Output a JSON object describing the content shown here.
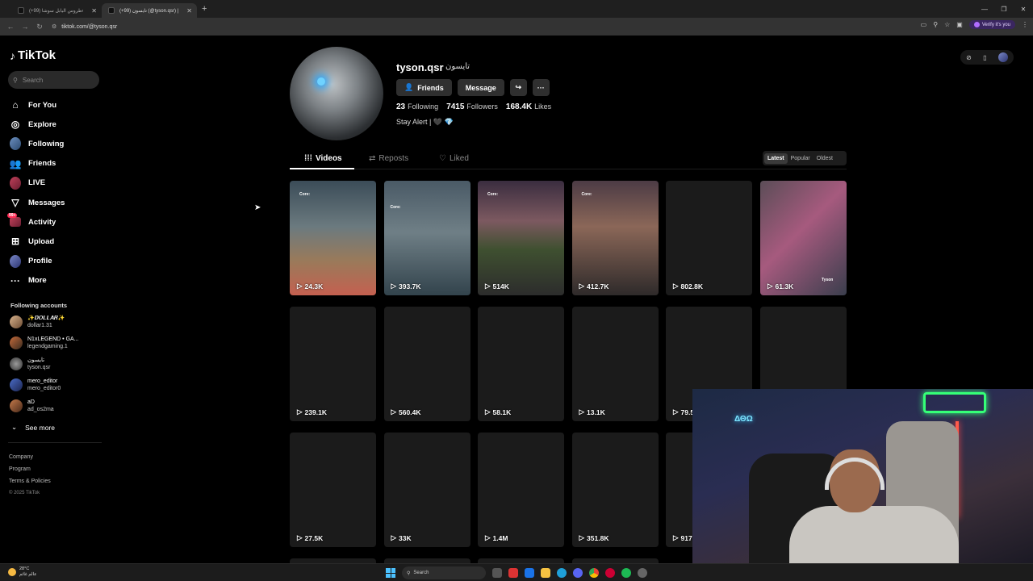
{
  "browser": {
    "tabs": [
      {
        "title": "(+99) طروس اليابل سوشا# | TikTok",
        "active": false
      },
      {
        "title": "(+99) تايسون (@tyson.qsr) | TikTok",
        "active": true
      }
    ],
    "url": "tiktok.com/@tyson.qsr",
    "verify_label": "Verify it's you"
  },
  "sidebar": {
    "logo": "TikTok",
    "search_placeholder": "Search",
    "nav": [
      {
        "label": "For You",
        "icon": "home-icon"
      },
      {
        "label": "Explore",
        "icon": "compass-icon"
      },
      {
        "label": "Following",
        "icon": "following-avatar-icon"
      },
      {
        "label": "Friends",
        "icon": "friends-icon"
      },
      {
        "label": "LIVE",
        "icon": "live-icon"
      },
      {
        "label": "Messages",
        "icon": "messages-icon"
      },
      {
        "label": "Activity",
        "icon": "activity-icon",
        "badge": "99+"
      },
      {
        "label": "Upload",
        "icon": "upload-icon"
      },
      {
        "label": "Profile",
        "icon": "profile-avatar-icon"
      },
      {
        "label": "More",
        "icon": "more-icon"
      }
    ],
    "following_title": "Following accounts",
    "accounts": [
      {
        "name": "✨𝑫𝑶𝑳𝑳𝑨𝑹✨",
        "handle": "dollar1.31"
      },
      {
        "name": "N1xLEGEND • GA...",
        "handle": "legendgaming.1"
      },
      {
        "name": "تايسون",
        "handle": "tyson.qsr"
      },
      {
        "name": "mero_editor",
        "handle": "mero_editor0"
      },
      {
        "name": "aD",
        "handle": "ad_os2ma"
      }
    ],
    "see_more": "See more",
    "footer": [
      "Company",
      "Program",
      "Terms & Policies"
    ],
    "copyright": "© 2025 TikTok"
  },
  "profile": {
    "username": "tyson.qsr",
    "nickname": "تايسون",
    "buttons": {
      "friends": "Friends",
      "message": "Message"
    },
    "following_count": "23",
    "following_label": "Following",
    "followers_count": "7415",
    "followers_label": "Followers",
    "likes_count": "168.4K",
    "likes_label": "Likes",
    "bio": "Stay Alert | 🖤 💎"
  },
  "content_tabs": {
    "videos": "Videos",
    "reposts": "Reposts",
    "liked": "Liked"
  },
  "sort": {
    "latest": "Latest",
    "popular": "Popular",
    "oldest": "Oldest"
  },
  "videos": [
    {
      "views": "24.3K"
    },
    {
      "views": "393.7K"
    },
    {
      "views": "514K"
    },
    {
      "views": "412.7K"
    },
    {
      "views": "802.8K"
    },
    {
      "views": "61.3K"
    },
    {
      "views": "239.1K"
    },
    {
      "views": "560.4K"
    },
    {
      "views": "58.1K"
    },
    {
      "views": "13.1K"
    },
    {
      "views": "79.5"
    },
    {
      "views": ""
    },
    {
      "views": "27.5K"
    },
    {
      "views": "33K"
    },
    {
      "views": "1.4M"
    },
    {
      "views": "351.8K"
    },
    {
      "views": "917"
    },
    {
      "views": ""
    }
  ],
  "thumb_labels": {
    "core": "Core:",
    "tyson": "Tyson"
  },
  "webcam": {
    "sign": "ΔΘΩ"
  },
  "taskbar": {
    "temp": "28°C",
    "weather_text": "عالم غائم",
    "search": "Search"
  }
}
